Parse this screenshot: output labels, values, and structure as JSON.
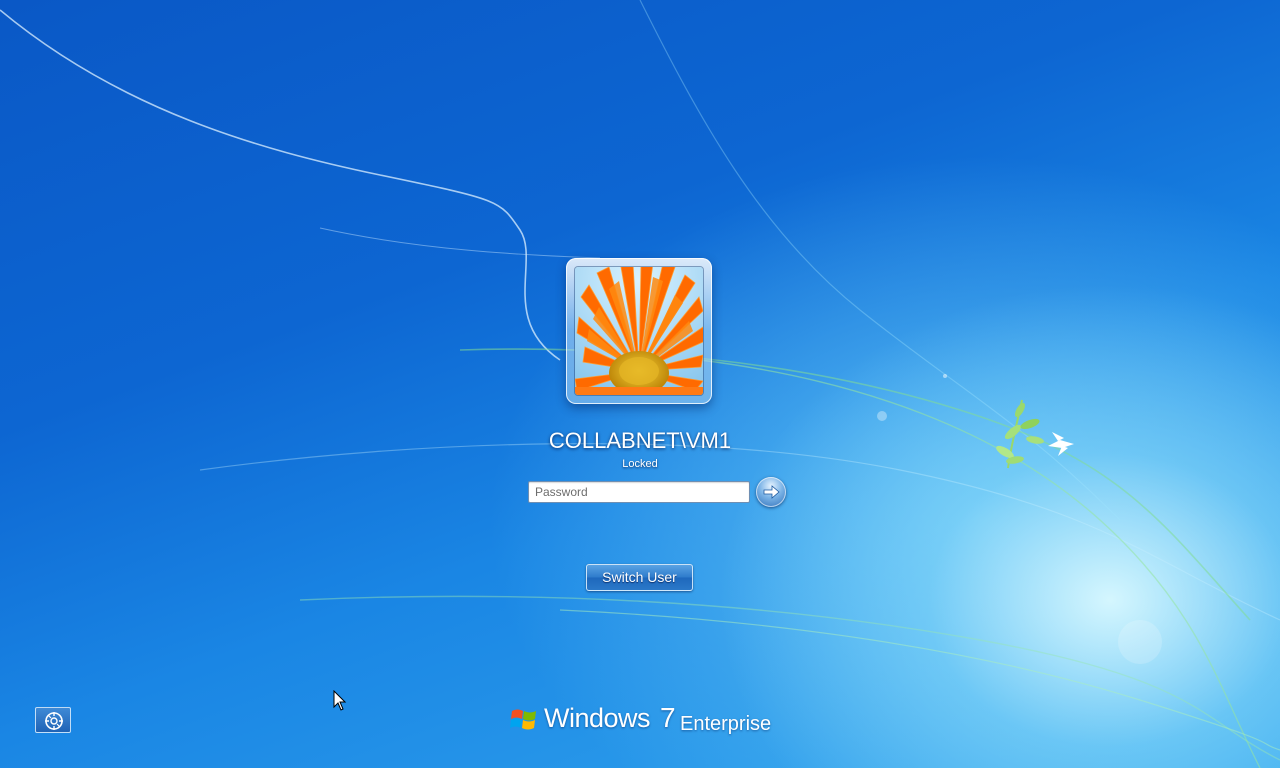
{
  "logon": {
    "user_picture": "orange-gerbera-flower",
    "user_name": "COLLABNET\\VM1",
    "status": "Locked",
    "password_placeholder": "Password",
    "password_value": "",
    "submit_icon": "arrow-right-icon"
  },
  "actions": {
    "switch_user_label": "Switch User"
  },
  "ease_of_access": {
    "icon": "ease-of-access-icon"
  },
  "branding": {
    "windows": "Windows",
    "version": "7",
    "edition": "Enterprise"
  },
  "colors": {
    "background_deep": "#0a58c6",
    "background_light": "#33a6ee",
    "flower_orange": "#ff6a00",
    "flower_center": "#e0a800"
  }
}
